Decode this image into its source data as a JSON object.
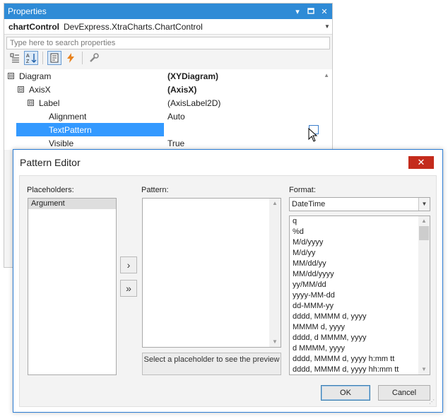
{
  "properties": {
    "title": "Properties",
    "object_name": "chartControl",
    "object_type": "DevExpress.XtraCharts.ChartControl",
    "search_placeholder": "Type here to search properties",
    "rows": [
      {
        "name": "Diagram",
        "value": "(XYDiagram)",
        "bold": true,
        "expander": "⊟"
      },
      {
        "name": "AxisX",
        "value": "(AxisX)",
        "bold": true,
        "expander": "⊟"
      },
      {
        "name": "Label",
        "value": "(AxisLabel2D)",
        "bold": false,
        "expander": "⊟"
      },
      {
        "name": "Alignment",
        "value": "Auto",
        "bold": false,
        "expander": ""
      },
      {
        "name": "TextPattern",
        "value": "",
        "bold": false,
        "expander": "",
        "selected": true
      },
      {
        "name": "Visible",
        "value": "True",
        "bold": false,
        "expander": ""
      }
    ]
  },
  "dialog": {
    "title": "Pattern Editor",
    "placeholders_label": "Placeholders:",
    "placeholders": [
      "Argument"
    ],
    "pattern_label": "Pattern:",
    "pattern_value": "",
    "hint": "Select a placeholder to see the preview",
    "format_label": "Format:",
    "format_selected": "DateTime",
    "format_items": [
      "q",
      "%d",
      "M/d/yyyy",
      "M/d/yy",
      "MM/dd/yy",
      "MM/dd/yyyy",
      "yy/MM/dd",
      "yyyy-MM-dd",
      "dd-MMM-yy",
      "dddd, MMMM d, yyyy",
      "MMMM d, yyyy",
      "dddd, d MMMM, yyyy",
      "d MMMM, yyyy",
      "dddd, MMMM d, yyyy h:mm tt",
      "dddd, MMMM d, yyyy hh:mm tt"
    ],
    "add_button": "›",
    "add_all_button": "»",
    "ok_label": "OK",
    "cancel_label": "Cancel",
    "close_glyph": "✕"
  },
  "colors": {
    "title_blue": "#2f8bd6",
    "selection_blue": "#3399ff",
    "close_red": "#c42b1c"
  }
}
